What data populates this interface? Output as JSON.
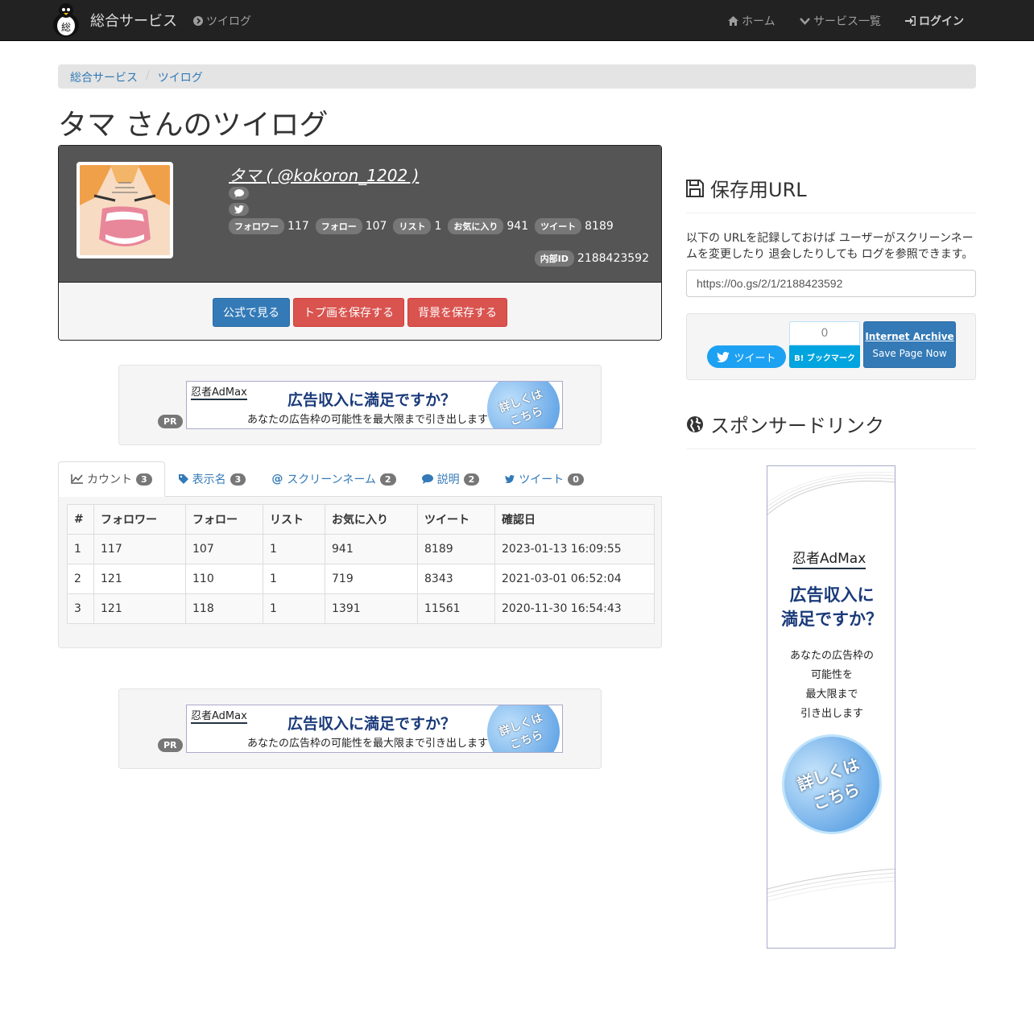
{
  "navbar": {
    "brand": "総合サービス",
    "twilog_link": "ツイログ",
    "home": "ホーム",
    "services": "サービス一覧",
    "login": "ログイン"
  },
  "breadcrumb": [
    "総合サービス",
    "ツイログ"
  ],
  "page_title": "タマ さんのツイログ",
  "profile": {
    "name": "タマ ( @kokoron_1202 )",
    "stats": [
      {
        "label": "フォロワー",
        "value": "117"
      },
      {
        "label": "フォロー",
        "value": "107"
      },
      {
        "label": "リスト",
        "value": "1"
      },
      {
        "label": "お気に入り",
        "value": "941"
      },
      {
        "label": "ツイート",
        "value": "8189"
      }
    ],
    "internal_id_label": "内部ID",
    "internal_id": "2188423592",
    "buttons": {
      "official": "公式で見る",
      "save_icon": "トプ画を保存する",
      "save_bg": "背景を保存する"
    }
  },
  "ad": {
    "pr": "PR",
    "logo": "忍者AdMax",
    "headline": "広告収入に満足ですか？",
    "sub": "あなたの広告枠の可能性を最大限まで引き出します",
    "circle1": "詳しくは",
    "circle2": "こちら"
  },
  "tabs": [
    {
      "label": "カウント",
      "count": "3"
    },
    {
      "label": "表示名",
      "count": "3"
    },
    {
      "label": "スクリーンネーム",
      "count": "2"
    },
    {
      "label": "説明",
      "count": "2"
    },
    {
      "label": "ツイート",
      "count": "0"
    }
  ],
  "table": {
    "headers": [
      "#",
      "フォロワー",
      "フォロー",
      "リスト",
      "お気に入り",
      "ツイート",
      "確認日"
    ],
    "rows": [
      [
        "1",
        "117",
        "107",
        "1",
        "941",
        "8189",
        "2023-01-13 16:09:55"
      ],
      [
        "2",
        "121",
        "110",
        "1",
        "719",
        "8343",
        "2021-03-01 06:52:04"
      ],
      [
        "3",
        "121",
        "118",
        "1",
        "1391",
        "11561",
        "2020-11-30 16:54:43"
      ]
    ]
  },
  "sidebar": {
    "save_url_title": "保存用URL",
    "save_url_desc": "以下の URLを記録しておけば ユーザーがスクリーンネームを変更したり 退会したりしても ログを参照できます。",
    "save_url_value": "https://0o.gs/2/1/2188423592",
    "tweet_button": "ツイート",
    "hatena_count": "0",
    "hatena_button": "B! ブックマーク",
    "ia_title": "Internet Archive",
    "ia_sub": "Save Page Now",
    "sponsor_title": "スポンサードリンク",
    "sky_logo": "忍者AdMax",
    "sky_head1": "広告収入に",
    "sky_head2": "満足ですか？",
    "sky_sub": [
      "あなたの広告枠の",
      "可能性を",
      "最大限まで",
      "引き出します"
    ],
    "sky_circle1": "詳しくは",
    "sky_circle2": "こちら"
  }
}
